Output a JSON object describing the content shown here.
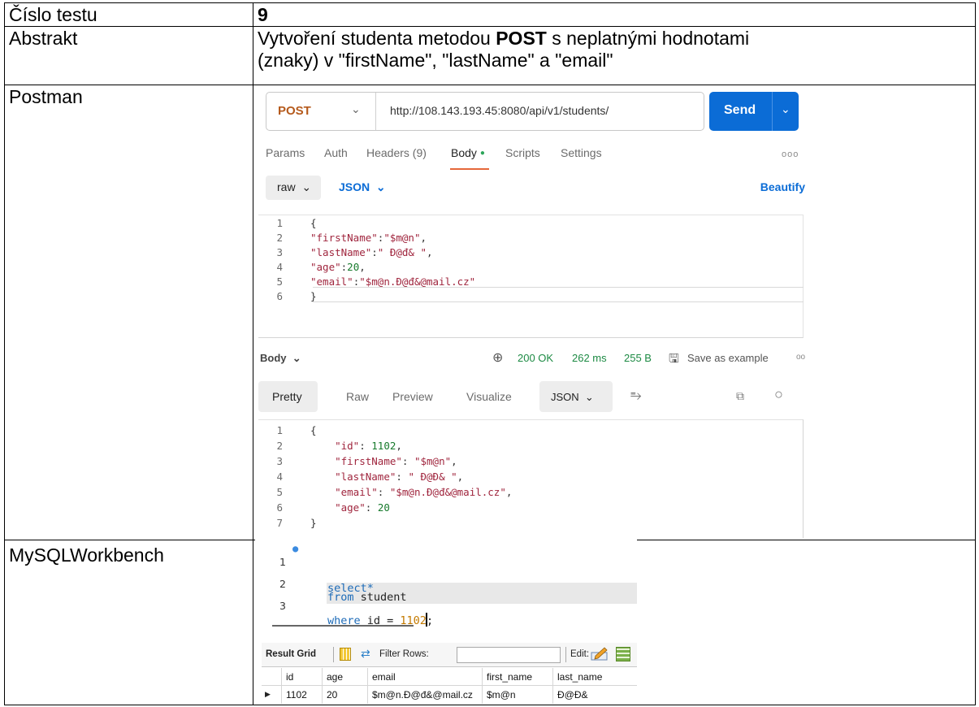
{
  "rows": {
    "cislo": {
      "label": "Číslo testu",
      "value": "9"
    },
    "abstrakt": {
      "label": "Abstrakt",
      "line1_pre": "Vytvoření studenta metodou ",
      "line1_bold": "POST",
      "line1_post": " s neplatnými hodnotami",
      "line2": "(znaky) v \"firstName\", \"lastName\" a \"email\""
    },
    "postman": {
      "label": "Postman"
    },
    "mysql": {
      "label": "MySQLWorkbench"
    }
  },
  "postman": {
    "method": "POST",
    "url": "http://108.143.193.45:8080/api/v1/students/",
    "send_label": "Send",
    "tabs": [
      "Params",
      "Auth",
      "Headers (9)",
      "Body",
      "Scripts",
      "Settings"
    ],
    "active_tab": "Body",
    "more": "ooo",
    "body_mode": "raw",
    "body_format": "JSON",
    "beautify": "Beautify",
    "request_lines": [
      {
        "n": "1",
        "text": "{"
      },
      {
        "n": "2",
        "text": "\"firstName\":\"$m@n\","
      },
      {
        "n": "3",
        "text": "\"lastName\":\" Đ@đ& \","
      },
      {
        "n": "4",
        "text": "\"age\":20,"
      },
      {
        "n": "5",
        "text": "\"email\":\"$m@n.Đ@đ&@mail.cz\""
      },
      {
        "n": "6",
        "text": "}"
      }
    ],
    "response": {
      "label": "Body",
      "status": "200 OK",
      "time": "262 ms",
      "size": "255 B",
      "save": "Save as example",
      "more": "oo",
      "tabs": [
        "Pretty",
        "Raw",
        "Preview",
        "Visualize"
      ],
      "format": "JSON",
      "lines": [
        {
          "n": "1",
          "text": "{"
        },
        {
          "n": "2",
          "text": "    \"id\": 1102,"
        },
        {
          "n": "3",
          "text": "    \"firstName\": \"$m@n\","
        },
        {
          "n": "4",
          "text": "    \"lastName\": \" Đ@Đ& \","
        },
        {
          "n": "5",
          "text": "    \"email\": \"$m@n.Đ@đ&@mail.cz\","
        },
        {
          "n": "6",
          "text": "    \"age\": 20"
        },
        {
          "n": "7",
          "text": "}"
        }
      ]
    }
  },
  "mysql": {
    "query": [
      {
        "n": "1",
        "kw": "select*",
        "rest": ""
      },
      {
        "n": "2",
        "kw": "from",
        "rest": " student"
      },
      {
        "n": "3",
        "kw": "where",
        "rest": " id = ",
        "num": "1102",
        "end": ";"
      }
    ],
    "toolbar": {
      "title": "Result Grid",
      "filter": "Filter Rows:",
      "edit": "Edit:"
    },
    "columns": [
      "id",
      "age",
      "email",
      "first_name",
      "last_name"
    ],
    "row": [
      "1102",
      "20",
      "$m@n.Đ@đ&@mail.cz",
      "$m@n",
      "Đ@Đ&"
    ]
  }
}
